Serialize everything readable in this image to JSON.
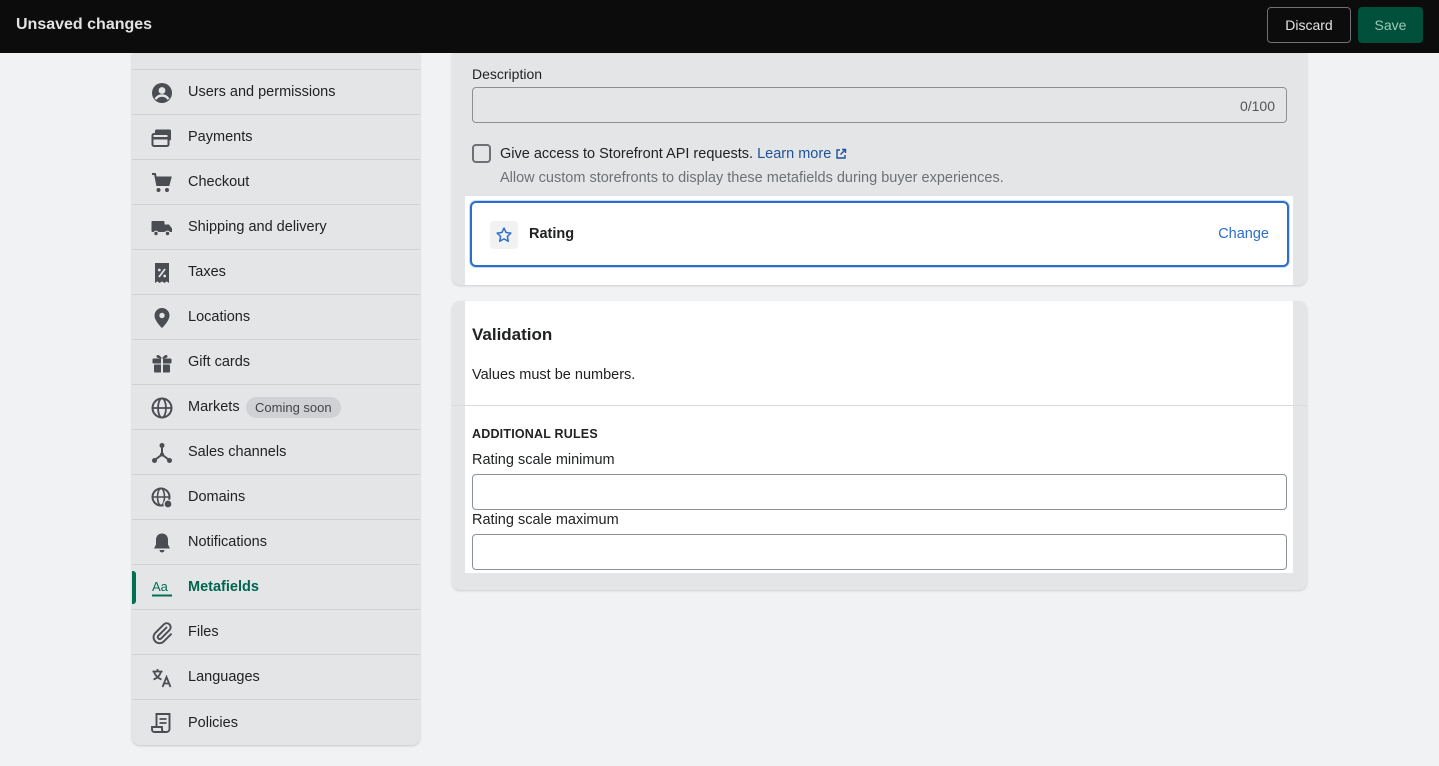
{
  "topbar": {
    "title": "Unsaved changes",
    "discard_label": "Discard",
    "save_label": "Save"
  },
  "sidebar": {
    "items": [
      {
        "label": "Users and permissions",
        "icon": "user-circle-icon"
      },
      {
        "label": "Payments",
        "icon": "payments-icon"
      },
      {
        "label": "Checkout",
        "icon": "cart-icon"
      },
      {
        "label": "Shipping and delivery",
        "icon": "truck-icon"
      },
      {
        "label": "Taxes",
        "icon": "receipt-percent-icon"
      },
      {
        "label": "Locations",
        "icon": "location-pin-icon"
      },
      {
        "label": "Gift cards",
        "icon": "gift-icon"
      },
      {
        "label": "Markets",
        "icon": "globe-icon",
        "badge": "Coming soon"
      },
      {
        "label": "Sales channels",
        "icon": "sales-channels-icon"
      },
      {
        "label": "Domains",
        "icon": "domain-globe-icon"
      },
      {
        "label": "Notifications",
        "icon": "bell-icon"
      },
      {
        "label": "Metafields",
        "icon": "metafields-icon",
        "active": true
      },
      {
        "label": "Files",
        "icon": "paperclip-icon"
      },
      {
        "label": "Languages",
        "icon": "translate-icon"
      },
      {
        "label": "Policies",
        "icon": "policy-document-icon"
      }
    ]
  },
  "definition": {
    "description_label": "Description",
    "description_value": "",
    "description_counter": "0/100",
    "storefront_checkbox_checked": false,
    "storefront_label": "Give access to Storefront API requests.",
    "learn_more": "Learn more",
    "storefront_help": "Allow custom storefronts to display these metafields during buyer experiences.",
    "type_name": "Rating",
    "type_icon": "star-icon",
    "change_label": "Change"
  },
  "validation": {
    "title": "Validation",
    "text": "Values must be numbers.",
    "additional_rules_heading": "ADDITIONAL RULES",
    "min_label": "Rating scale minimum",
    "min_value": "",
    "max_label": "Rating scale maximum",
    "max_value": ""
  },
  "colors": {
    "accent": "#2c6ecb",
    "active_nav": "#006e52",
    "save_button": "#00503b"
  }
}
